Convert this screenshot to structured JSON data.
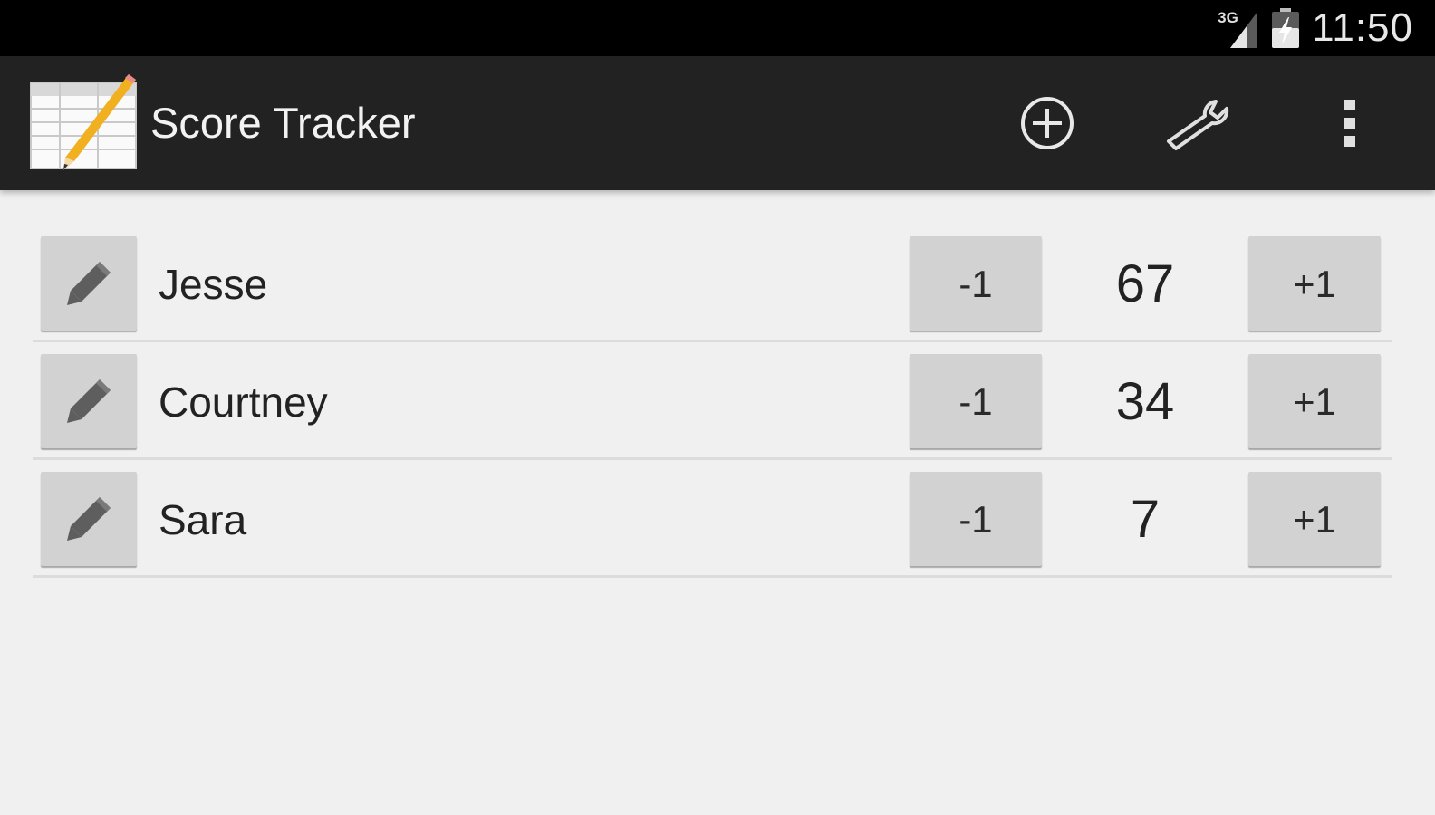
{
  "status_bar": {
    "network_type": "3G",
    "time": "11:50",
    "icons": [
      "signal-icon",
      "battery-icon"
    ]
  },
  "action_bar": {
    "title": "Score Tracker",
    "app_icon": "score-sheet-pencil-icon",
    "actions": [
      {
        "name": "add-player",
        "icon": "plus-circle-icon"
      },
      {
        "name": "settings",
        "icon": "wrench-icon"
      },
      {
        "name": "overflow",
        "icon": "more-vertical-icon"
      }
    ]
  },
  "players": [
    {
      "name": "Jesse",
      "score": "67",
      "minus_label": "-1",
      "plus_label": "+1",
      "edit_icon": "pencil-icon"
    },
    {
      "name": "Courtney",
      "score": "34",
      "minus_label": "-1",
      "plus_label": "+1",
      "edit_icon": "pencil-icon"
    },
    {
      "name": "Sara",
      "score": "7",
      "minus_label": "-1",
      "plus_label": "+1",
      "edit_icon": "pencil-icon"
    }
  ],
  "colors": {
    "status_bar": "#000000",
    "action_bar": "#222222",
    "background": "#f0f0f0",
    "button": "#d2d2d2",
    "divider": "#dcdcdc"
  }
}
